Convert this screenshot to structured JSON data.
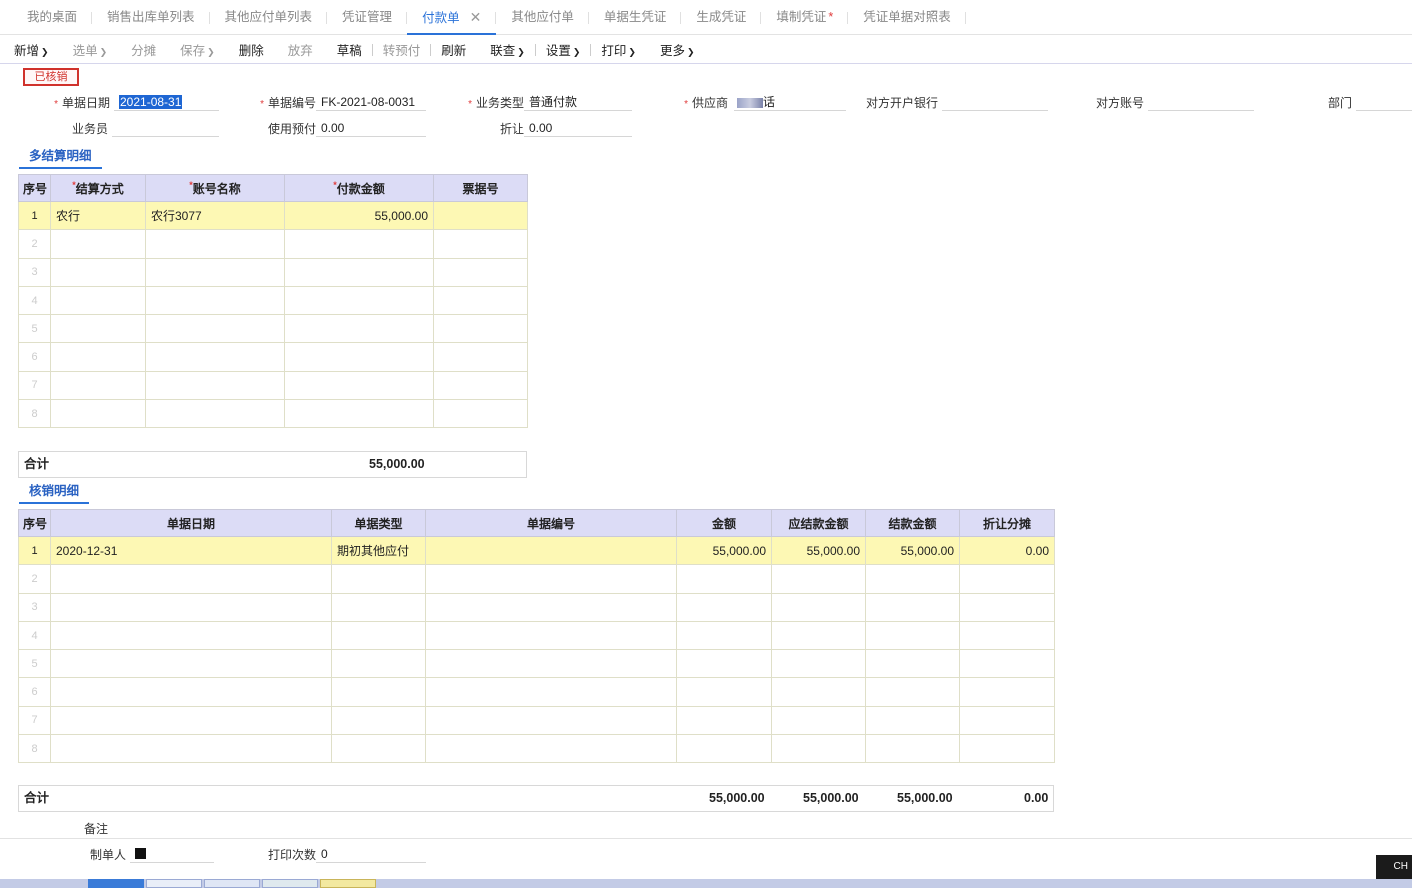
{
  "tabs": [
    {
      "label": "我的桌面"
    },
    {
      "label": "销售出库单列表"
    },
    {
      "label": "其他应付单列表"
    },
    {
      "label": "凭证管理"
    },
    {
      "label": "付款单",
      "active": true
    },
    {
      "label": "其他应付单"
    },
    {
      "label": "单据生凭证"
    },
    {
      "label": "生成凭证"
    },
    {
      "label": "填制凭证",
      "modified": "*"
    },
    {
      "label": "凭证单据对照表"
    }
  ],
  "toolbar": {
    "new": "新增",
    "pick": "选单",
    "split": "分摊",
    "save": "保存",
    "delete": "删除",
    "discard": "放弃",
    "draft": "草稿",
    "prepay": "转预付",
    "refresh": "刷新",
    "linked": "联查",
    "settings": "设置",
    "print": "打印",
    "more": "更多"
  },
  "status_stamp": "已核销",
  "form": {
    "doc_date": {
      "label": "单据日期",
      "value": "2021-08-31"
    },
    "doc_no": {
      "label": "单据编号",
      "value": "FK-2021-08-0031"
    },
    "biz_type": {
      "label": "业务类型",
      "value": "普通付款"
    },
    "supplier": {
      "label": "供应商",
      "value_suffix": "话"
    },
    "bank": {
      "label": "对方开户银行",
      "value": ""
    },
    "account": {
      "label": "对方账号",
      "value": ""
    },
    "dept": {
      "label": "部门",
      "value": ""
    },
    "salesman": {
      "label": "业务员",
      "value": ""
    },
    "prepay_used": {
      "label": "使用预付",
      "value": "0.00"
    },
    "discount": {
      "label": "折让",
      "value": "0.00"
    },
    "remark": {
      "label": "备注",
      "value": ""
    },
    "maker": {
      "label": "制单人",
      "value": "台"
    },
    "print_count": {
      "label": "打印次数",
      "value": "0"
    }
  },
  "settle": {
    "title": "多结算明细",
    "columns": [
      "序号",
      "结算方式",
      "账号名称",
      "付款金额",
      "票据号"
    ],
    "rows": [
      {
        "idx": "1",
        "method": "农行",
        "account": "农行3077",
        "amount": "55,000.00",
        "ticket": ""
      },
      {
        "idx": "2"
      },
      {
        "idx": "3"
      },
      {
        "idx": "4"
      },
      {
        "idx": "5"
      },
      {
        "idx": "6"
      },
      {
        "idx": "7"
      },
      {
        "idx": "8"
      }
    ],
    "total_label": "合计",
    "total_amount": "55,000.00"
  },
  "writeoff": {
    "title": "核销明细",
    "columns": [
      "序号",
      "单据日期",
      "单据类型",
      "单据编号",
      "金额",
      "应结款金额",
      "结款金额",
      "折让分摊"
    ],
    "rows": [
      {
        "idx": "1",
        "date": "2020-12-31",
        "type": "期初其他应付",
        "no": "",
        "amount": "55,000.00",
        "due": "55,000.00",
        "paid": "55,000.00",
        "disc": "0.00"
      },
      {
        "idx": "2"
      },
      {
        "idx": "3"
      },
      {
        "idx": "4"
      },
      {
        "idx": "5"
      },
      {
        "idx": "6"
      },
      {
        "idx": "7"
      },
      {
        "idx": "8"
      }
    ],
    "total_label": "合计",
    "totals": {
      "amount": "55,000.00",
      "due": "55,000.00",
      "paid": "55,000.00",
      "disc": "0.00"
    }
  },
  "ime_indicator": "CH"
}
